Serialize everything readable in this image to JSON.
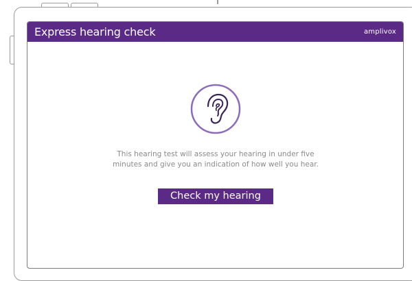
{
  "header": {
    "title": "Express hearing check",
    "brand": "amplivox"
  },
  "main": {
    "icon": "ear-icon",
    "description_line1": "This hearing test will assess your hearing in under five",
    "description_line2": "minutes and give you an indication of how well you hear.",
    "cta_label": "Check my hearing"
  },
  "colors": {
    "brand_purple": "#5b2a86",
    "icon_ring": "#8c6bb8",
    "body_text": "#8a8a8a"
  }
}
